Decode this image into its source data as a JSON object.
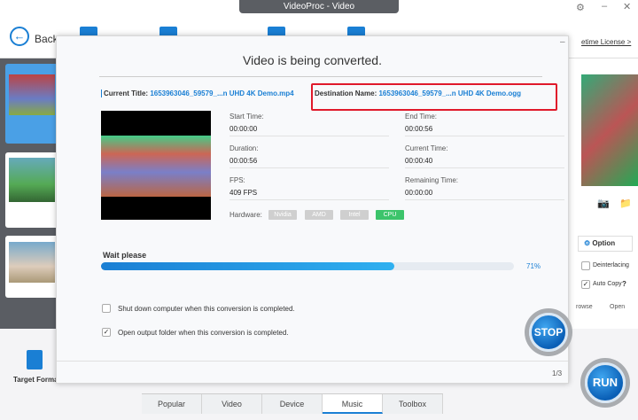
{
  "window": {
    "title": "VideoProc - Video"
  },
  "toolbar": {
    "back_label": "Back",
    "license_link": "etime License >"
  },
  "dialog": {
    "title": "Video is being converted.",
    "current_title_label": "Current Title:",
    "current_title_value": "1653963046_59579_...n UHD 4K Demo.mp4",
    "destination_label": "Destination Name:",
    "destination_value": "1653963046_59579_...n UHD 4K Demo.ogg",
    "stats": {
      "start_time_label": "Start Time:",
      "start_time": "00:00:00",
      "end_time_label": "End Time:",
      "end_time": "00:00:56",
      "duration_label": "Duration:",
      "duration": "00:00:56",
      "current_time_label": "Current Time:",
      "current_time": "00:00:40",
      "fps_label": "FPS:",
      "fps": "409 FPS",
      "remaining_label": "Remaining Time:",
      "remaining": "00:00:00"
    },
    "hardware_label": "Hardware:",
    "hardware": [
      "Nvidia",
      "AMD",
      "Intel",
      "CPU"
    ],
    "hardware_active": "CPU",
    "progress_label": "Wait please",
    "progress_percent": 71,
    "progress_text": "71%",
    "shutdown_option": "Shut down computer when this conversion is completed.",
    "shutdown_checked": false,
    "open_folder_option": "Open output folder when this conversion is completed.",
    "open_folder_checked": true,
    "stop_label": "STOP",
    "page_counter": "1/3"
  },
  "right_panel": {
    "option_label": "Option",
    "deinterlacing_label": "Deinterlacing",
    "auto_copy_label": "Auto Copy",
    "help": "?",
    "browse_label": "rowse",
    "open_label": "Open"
  },
  "bottom": {
    "target_format_label": "Target Format",
    "run_label": "RUN",
    "tabs": [
      "Popular",
      "Video",
      "Device",
      "Music",
      "Toolbox"
    ],
    "active_tab": "Music"
  },
  "colors": {
    "accent": "#1a7fd4",
    "cpu_active": "#3cc46b",
    "highlight_box": "#e0192b"
  }
}
